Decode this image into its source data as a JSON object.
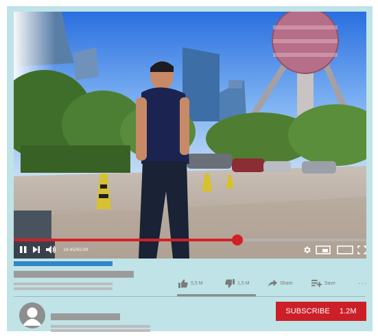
{
  "player": {
    "time_current": "10:45",
    "time_total": "65:00",
    "progress_fraction": 0.6346,
    "icons": [
      "pause-icon",
      "next-icon",
      "volume-icon",
      "settings-icon",
      "miniplayer-icon",
      "theater-icon",
      "fullscreen-icon"
    ],
    "accent_color": "#d32027"
  },
  "actions": {
    "like_count": "5,5 M",
    "dislike_count": "1,5 M",
    "share_label": "Share",
    "save_label": "Save",
    "more_label": "···"
  },
  "channel": {
    "subscribe_label": "SUBSCRIBE",
    "subscriber_count": "1.2M",
    "subscribe_color": "#cc1f28"
  }
}
